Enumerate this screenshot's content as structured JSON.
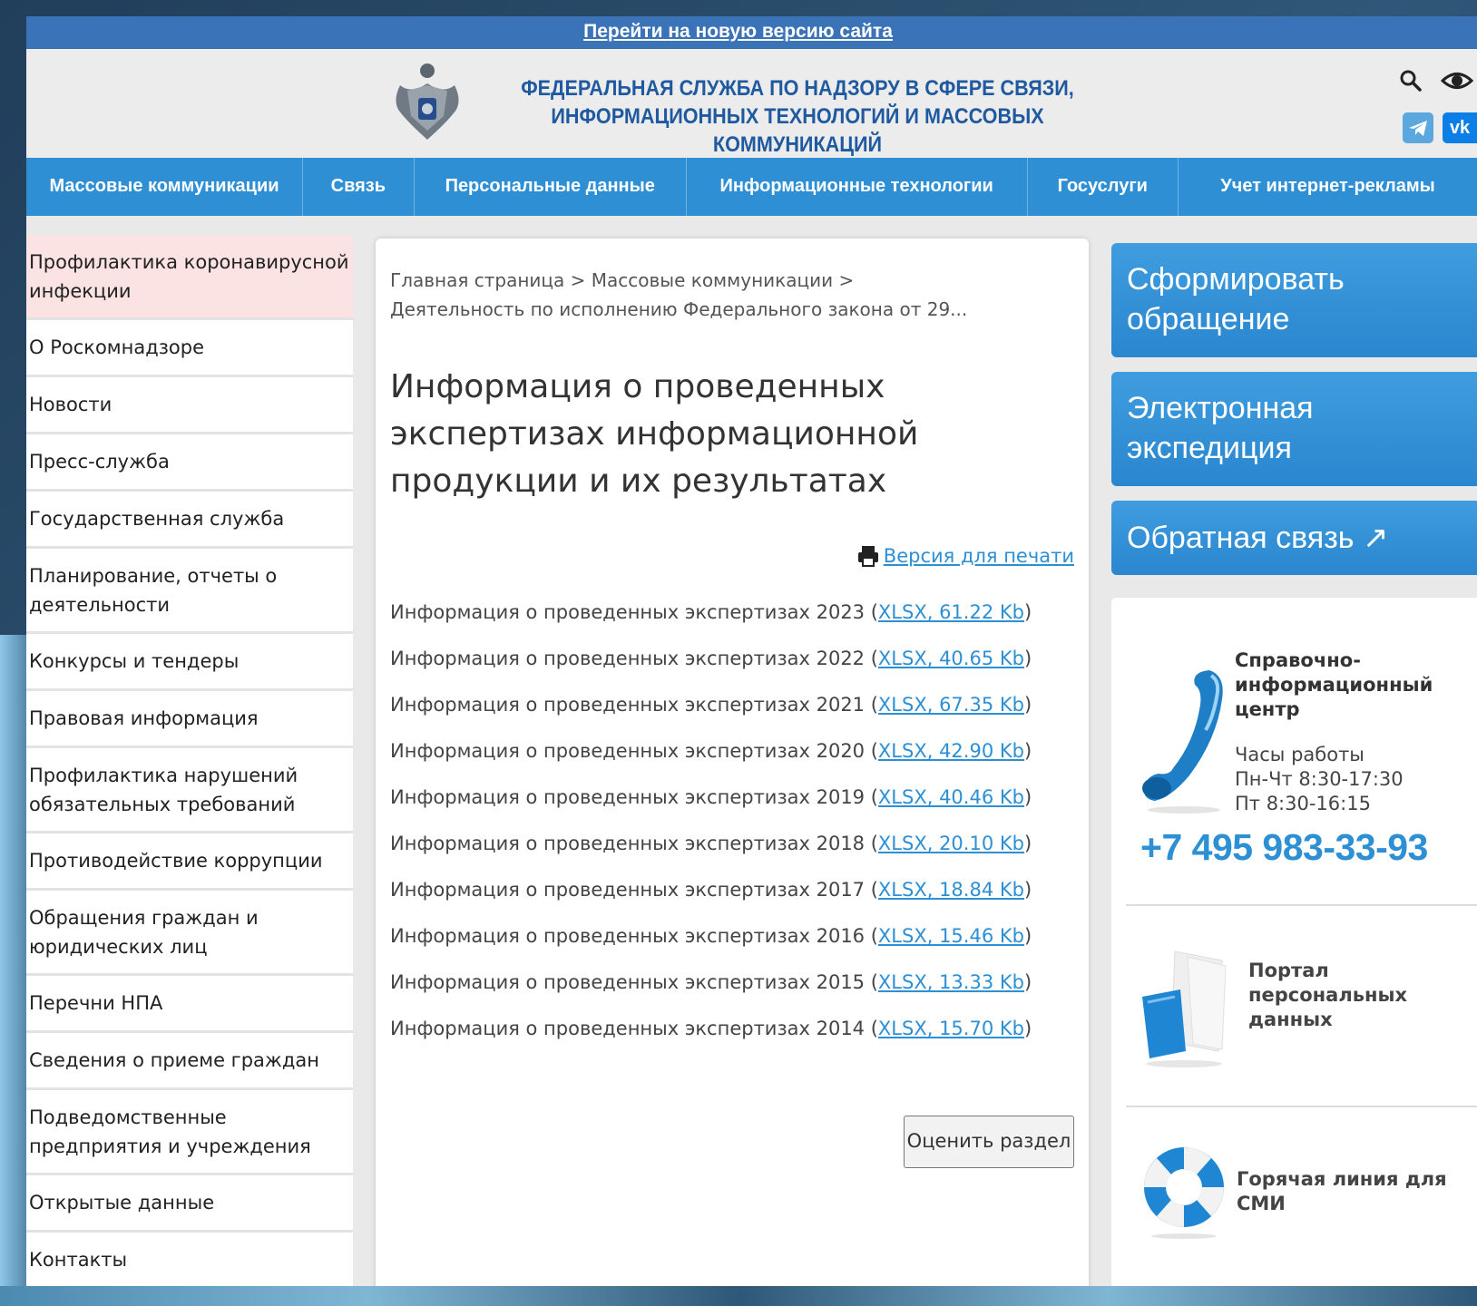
{
  "topbar": {
    "link": "Перейти на новую версию сайта"
  },
  "header": {
    "title_line1": "ФЕДЕРАЛЬНАЯ СЛУЖБА ПО НАДЗОРУ В СФЕРЕ СВЯЗИ,",
    "title_line2": "ИНФОРМАЦИОННЫХ ТЕХНОЛОГИЙ И МАССОВЫХ КОММУНИКАЦИЙ",
    "vk_label": "vk"
  },
  "nav": [
    "Массовые коммуникации",
    "Связь",
    "Персональные данные",
    "Информационные технологии",
    "Госуслуги",
    "Учет интернет-рекламы"
  ],
  "sidebar": [
    "Профилактика коронавирусной инфекции",
    "О Роскомнадзоре",
    "Новости",
    "Пресс-служба",
    "Государственная служба",
    "Планирование, отчеты о деятельности",
    "Конкурсы и тендеры",
    "Правовая информация",
    "Профилактика нарушений обязательных требований",
    "Противодействие коррупции",
    "Обращения граждан и юридических лиц",
    "Перечни НПА",
    "Сведения о приеме граждан",
    "Подведомственные предприятия и учреждения",
    "Открытые данные",
    "Контакты"
  ],
  "breadcrumb": {
    "line1": "Главная страница > Массовые коммуникации >",
    "line2": "Деятельность по исполнению Федерального закона от 29..."
  },
  "page_title": "Информация о проведенных экспертизах информационной продукции и их результатах",
  "print_link": "Версия для печати",
  "files": [
    {
      "text": "Информация о проведенных экспертизах 2023",
      "link": "XLSX, 61.22 Kb"
    },
    {
      "text": "Информация о проведенных экспертизах 2022",
      "link": "XLSX, 40.65 Kb"
    },
    {
      "text": "Информация о проведенных экспертизах 2021",
      "link": "XLSX, 67.35 Kb"
    },
    {
      "text": "Информация о проведенных экспертизах 2020",
      "link": "XLSX, 42.90 Kb"
    },
    {
      "text": "Информация о проведенных экспертизах 2019",
      "link": "XLSX, 40.46 Kb"
    },
    {
      "text": "Информация о проведенных экспертизах 2018",
      "link": "XLSX, 20.10 Kb"
    },
    {
      "text": "Информация о проведенных экспертизах 2017",
      "link": "XLSX, 18.84 Kb"
    },
    {
      "text": "Информация о проведенных экспертизах 2016",
      "link": "XLSX, 15.46 Kb"
    },
    {
      "text": "Информация о проведенных экспертизах 2015",
      "link": "XLSX, 13.33 Kb"
    },
    {
      "text": "Информация о проведенных экспертизах 2014",
      "link": "XLSX, 15.70 Kb"
    }
  ],
  "rate_button": "Оценить раздел",
  "right": {
    "btn1": "Сформировать обращение",
    "btn2": "Электронная экспедиция",
    "btn3": "Обратная связь ↗",
    "info_title": "Справочно-информационный центр",
    "hours_label": "Часы работы",
    "hours_1": "Пн-Чт 8:30-17:30",
    "hours_2": "Пт 8:30-16:15",
    "phone": "+7 495 983-33-93",
    "portal": "Портал персональных данных",
    "hotline": "Горячая линия для СМИ"
  },
  "colors": {
    "nav": "#2f8fd4",
    "link": "#2d8fd4",
    "topbar": "#3b73b9",
    "active": "#fbe3e3"
  }
}
